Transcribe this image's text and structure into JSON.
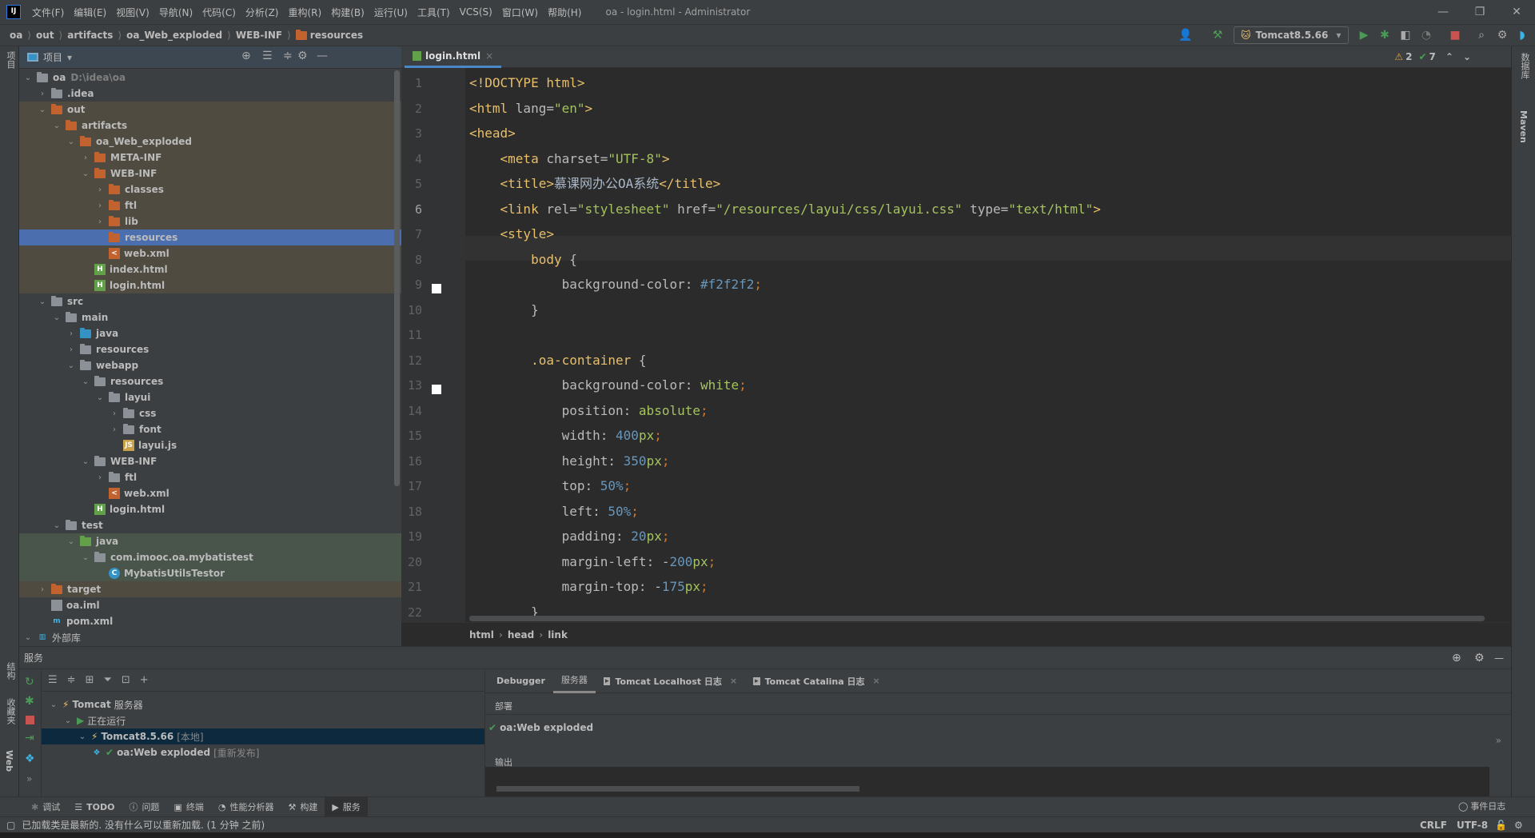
{
  "window": {
    "title": "oa - login.html - Administrator",
    "logo": "IJ"
  },
  "menu": [
    "文件(F)",
    "编辑(E)",
    "视图(V)",
    "导航(N)",
    "代码(C)",
    "分析(Z)",
    "重构(R)",
    "构建(B)",
    "运行(U)",
    "工具(T)",
    "VCS(S)",
    "窗口(W)",
    "帮助(H)"
  ],
  "breadcrumb": [
    "oa",
    "out",
    "artifacts",
    "oa_Web_exploded",
    "WEB-INF",
    "resources"
  ],
  "toolbar": {
    "run_config": "Tomcat8.5.66"
  },
  "colors": {
    "accent": "#4b6eaf",
    "excluded": "#4f4b41",
    "test": "#49544a",
    "run": "#499c54",
    "stop": "#c75450"
  },
  "left_strip": {
    "project": "项目",
    "structure": "结构",
    "favorites": "收藏夹",
    "web": "Web"
  },
  "right_strip": {
    "database": "数据库",
    "maven": "Maven"
  },
  "project": {
    "title": "项目",
    "items": [
      {
        "lvl": 0,
        "name": "oa",
        "hint": "D:\\idea\\oa",
        "arrow": "down",
        "icon": "module"
      },
      {
        "lvl": 1,
        "name": ".idea",
        "arrow": "right",
        "icon": "grey"
      },
      {
        "lvl": 1,
        "name": "out",
        "arrow": "down",
        "icon": "orange",
        "bg": "ex"
      },
      {
        "lvl": 2,
        "name": "artifacts",
        "arrow": "down",
        "icon": "orange",
        "bg": "ex"
      },
      {
        "lvl": 3,
        "name": "oa_Web_exploded",
        "arrow": "down",
        "icon": "orange",
        "bg": "ex"
      },
      {
        "lvl": 4,
        "name": "META-INF",
        "arrow": "right",
        "icon": "orange",
        "bg": "ex"
      },
      {
        "lvl": 4,
        "name": "WEB-INF",
        "arrow": "down",
        "icon": "orange",
        "bg": "ex"
      },
      {
        "lvl": 5,
        "name": "classes",
        "arrow": "right",
        "icon": "orange",
        "bg": "ex"
      },
      {
        "lvl": 5,
        "name": "ftl",
        "arrow": "right",
        "icon": "orange",
        "bg": "ex"
      },
      {
        "lvl": 5,
        "name": "lib",
        "arrow": "right",
        "icon": "orange",
        "bg": "ex"
      },
      {
        "lvl": 5,
        "name": "resources",
        "arrow": "",
        "icon": "orange",
        "bg": "sel"
      },
      {
        "lvl": 5,
        "name": "web.xml",
        "arrow": "",
        "icon": "xml",
        "bg": "ex"
      },
      {
        "lvl": 4,
        "name": "index.html",
        "arrow": "",
        "icon": "html",
        "bg": "ex"
      },
      {
        "lvl": 4,
        "name": "login.html",
        "arrow": "",
        "icon": "html",
        "bg": "ex"
      },
      {
        "lvl": 1,
        "name": "src",
        "arrow": "down",
        "icon": "grey"
      },
      {
        "lvl": 2,
        "name": "main",
        "arrow": "down",
        "icon": "grey"
      },
      {
        "lvl": 3,
        "name": "java",
        "arrow": "right",
        "icon": "blue"
      },
      {
        "lvl": 3,
        "name": "resources",
        "arrow": "right",
        "icon": "res"
      },
      {
        "lvl": 3,
        "name": "webapp",
        "arrow": "down",
        "icon": "web"
      },
      {
        "lvl": 4,
        "name": "resources",
        "arrow": "down",
        "icon": "grey"
      },
      {
        "lvl": 5,
        "name": "layui",
        "arrow": "down",
        "icon": "grey"
      },
      {
        "lvl": 6,
        "name": "css",
        "arrow": "right",
        "icon": "grey"
      },
      {
        "lvl": 6,
        "name": "font",
        "arrow": "right",
        "icon": "grey"
      },
      {
        "lvl": 6,
        "name": "layui.js",
        "arrow": "",
        "icon": "js"
      },
      {
        "lvl": 4,
        "name": "WEB-INF",
        "arrow": "down",
        "icon": "grey"
      },
      {
        "lvl": 5,
        "name": "ftl",
        "arrow": "right",
        "icon": "grey"
      },
      {
        "lvl": 5,
        "name": "web.xml",
        "arrow": "",
        "icon": "xml"
      },
      {
        "lvl": 4,
        "name": "login.html",
        "arrow": "",
        "icon": "html"
      },
      {
        "lvl": 2,
        "name": "test",
        "arrow": "down",
        "icon": "grey"
      },
      {
        "lvl": 3,
        "name": "java",
        "arrow": "down",
        "icon": "green",
        "bg": "test"
      },
      {
        "lvl": 4,
        "name": "com.imooc.oa.mybatistest",
        "arrow": "down",
        "icon": "pkg",
        "bg": "test"
      },
      {
        "lvl": 5,
        "name": "MybatisUtilsTestor",
        "arrow": "",
        "icon": "class",
        "bg": "test"
      },
      {
        "lvl": 1,
        "name": "target",
        "arrow": "right",
        "icon": "orange",
        "bg": "ex"
      },
      {
        "lvl": 1,
        "name": "oa.iml",
        "arrow": "",
        "icon": "iml"
      },
      {
        "lvl": 1,
        "name": "pom.xml",
        "arrow": "",
        "icon": "maven"
      },
      {
        "lvl": 0,
        "name": "外部库",
        "arrow": "down",
        "icon": "lib"
      }
    ]
  },
  "editor": {
    "tab": "login.html",
    "warnings": "2",
    "checks": "7",
    "breadcrumb": [
      "html",
      "head",
      "link"
    ],
    "lines": [
      [
        [
          "<!DOCTYPE html>",
          "tag"
        ]
      ],
      [
        [
          "<html ",
          "tag"
        ],
        [
          "lang=",
          "attr"
        ],
        [
          "\"en\"",
          "str"
        ],
        [
          ">",
          "tag"
        ]
      ],
      [
        [
          "<head>",
          "tag"
        ]
      ],
      [
        [
          "    "
        ],
        [
          "<meta ",
          "tag"
        ],
        [
          "charset=",
          "attr"
        ],
        [
          "\"UTF-8\"",
          "str"
        ],
        [
          ">",
          "tag"
        ]
      ],
      [
        [
          "    "
        ],
        [
          "<title>",
          "tag"
        ],
        [
          "慕课网办公OA系统",
          "txt"
        ],
        [
          "</title>",
          "tag"
        ]
      ],
      [
        [
          "    "
        ],
        [
          "<link ",
          "tag"
        ],
        [
          "rel=",
          "attr"
        ],
        [
          "\"stylesheet\"",
          "str"
        ],
        [
          " href=",
          "attr"
        ],
        [
          "\"/resources/layui/css/layui.css\"",
          "str"
        ],
        [
          " type=",
          "attr"
        ],
        [
          "\"text/html\"",
          "str"
        ],
        [
          ">",
          "tag"
        ]
      ],
      [
        [
          "    "
        ],
        [
          "<style>",
          "tag"
        ]
      ],
      [
        [
          "        "
        ],
        [
          "body ",
          "sel"
        ],
        [
          "{",
          "pun"
        ]
      ],
      [
        [
          "            "
        ],
        [
          "background-color",
          "prop"
        ],
        [
          ": ",
          "pun"
        ],
        [
          "#f2f2f2",
          "num"
        ],
        [
          ";",
          "semi"
        ]
      ],
      [
        [
          "        "
        ],
        [
          "}",
          "pun"
        ]
      ],
      [
        [
          ""
        ]
      ],
      [
        [
          "        "
        ],
        [
          ".oa-container ",
          "sel"
        ],
        [
          "{",
          "pun"
        ]
      ],
      [
        [
          "            "
        ],
        [
          "background-color",
          "prop"
        ],
        [
          ": ",
          "pun"
        ],
        [
          "white",
          "kw"
        ],
        [
          ";",
          "semi"
        ]
      ],
      [
        [
          "            "
        ],
        [
          "position",
          "prop"
        ],
        [
          ": ",
          "pun"
        ],
        [
          "absolute",
          "kw"
        ],
        [
          ";",
          "semi"
        ]
      ],
      [
        [
          "            "
        ],
        [
          "width",
          "prop"
        ],
        [
          ": ",
          "pun"
        ],
        [
          "400",
          "num"
        ],
        [
          "px",
          "kw"
        ],
        [
          ";",
          "semi"
        ]
      ],
      [
        [
          "            "
        ],
        [
          "height",
          "prop"
        ],
        [
          ": ",
          "pun"
        ],
        [
          "350",
          "num"
        ],
        [
          "px",
          "kw"
        ],
        [
          ";",
          "semi"
        ]
      ],
      [
        [
          "            "
        ],
        [
          "top",
          "prop"
        ],
        [
          ": ",
          "pun"
        ],
        [
          "50%",
          "num"
        ],
        [
          ";",
          "semi"
        ]
      ],
      [
        [
          "            "
        ],
        [
          "left",
          "prop"
        ],
        [
          ": ",
          "pun"
        ],
        [
          "50%",
          "num"
        ],
        [
          ";",
          "semi"
        ]
      ],
      [
        [
          "            "
        ],
        [
          "padding",
          "prop"
        ],
        [
          ": ",
          "pun"
        ],
        [
          "20",
          "num"
        ],
        [
          "px",
          "kw"
        ],
        [
          ";",
          "semi"
        ]
      ],
      [
        [
          "            "
        ],
        [
          "margin-left",
          "prop"
        ],
        [
          ": -",
          "pun"
        ],
        [
          "200",
          "num"
        ],
        [
          "px",
          "kw"
        ],
        [
          ";",
          "semi"
        ]
      ],
      [
        [
          "            "
        ],
        [
          "margin-top",
          "prop"
        ],
        [
          ": -",
          "pun"
        ],
        [
          "175",
          "num"
        ],
        [
          "px",
          "kw"
        ],
        [
          ";",
          "semi"
        ]
      ],
      [
        [
          "        "
        ],
        [
          "}",
          "pun"
        ]
      ]
    ]
  },
  "services": {
    "title": "服务",
    "tree": [
      {
        "lvl": 0,
        "name": "Tomcat",
        "suffix": "服务器",
        "icon": "tomcat"
      },
      {
        "lvl": 1,
        "name": "正在运行",
        "suffix": "",
        "icon": "run"
      },
      {
        "lvl": 2,
        "name": "Tomcat8.5.66",
        "suffix": "[本地]",
        "icon": "tomcat",
        "selected": true
      },
      {
        "lvl": 3,
        "name": "oa:Web exploded",
        "suffix": "[重新发布]",
        "icon": "check"
      }
    ],
    "tabs": [
      "Debugger",
      "服务器",
      "Tomcat Localhost 日志",
      "Tomcat Catalina 日志"
    ],
    "deploy_label": "部署",
    "deploy_item": "oa:Web exploded",
    "output_label": "输出"
  },
  "bottom_tabs": [
    "调试",
    "TODO",
    "问题",
    "终端",
    "性能分析器",
    "构建",
    "服务"
  ],
  "event_log": "事件日志",
  "status": {
    "message": "已加载类是最新的. 没有什么可以重新加载. (1 分钟 之前)",
    "line_sep": "CRLF",
    "encoding": "UTF-8"
  }
}
